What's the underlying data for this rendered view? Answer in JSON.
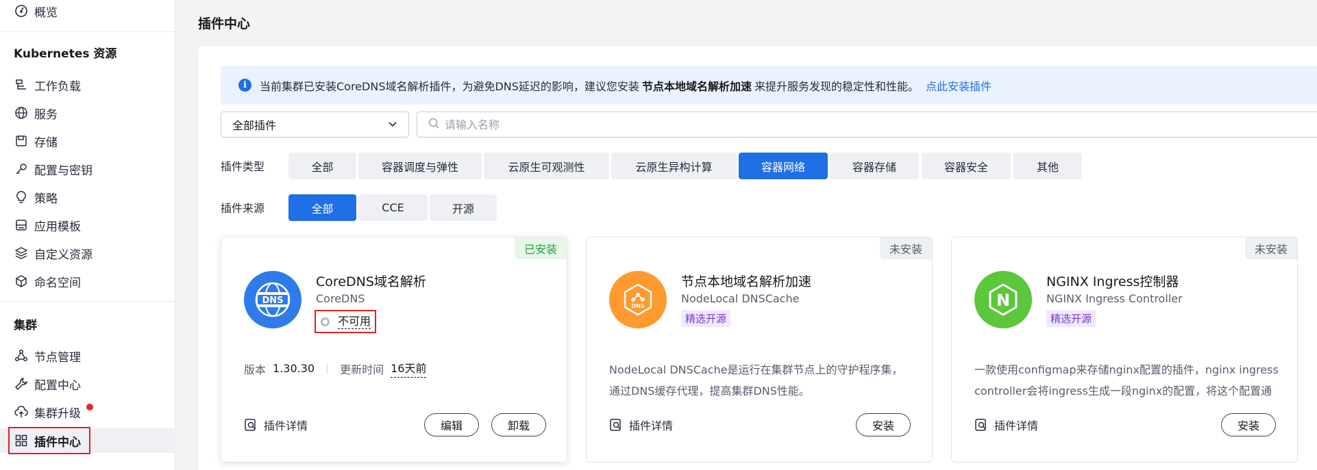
{
  "sidebar": {
    "overview": "概览",
    "k8s_section": "Kubernetes 资源",
    "items": [
      {
        "label": "工作负载",
        "icon": "workload-icon"
      },
      {
        "label": "服务",
        "icon": "globe-icon"
      },
      {
        "label": "存储",
        "icon": "storage-icon"
      },
      {
        "label": "配置与密钥",
        "icon": "key-icon"
      },
      {
        "label": "策略",
        "icon": "bulb-icon"
      },
      {
        "label": "应用模板",
        "icon": "template-icon"
      },
      {
        "label": "自定义资源",
        "icon": "layers-icon"
      },
      {
        "label": "命名空间",
        "icon": "cube-icon"
      }
    ],
    "cluster_section": "集群",
    "cluster_items": [
      {
        "label": "节点管理",
        "icon": "node-icon"
      },
      {
        "label": "配置中心",
        "icon": "wrench-icon"
      },
      {
        "label": "集群升级",
        "icon": "cloud-upload-icon"
      },
      {
        "label": "插件中心",
        "icon": "grid-icon"
      }
    ]
  },
  "header": {
    "title": "插件中心"
  },
  "notice": {
    "text_before": "当前集群已安装CoreDNS域名解析插件，为避免DNS延迟的影响，建议您安装",
    "bold": "节点本地域名解析加速",
    "text_after": "来提升服务发现的稳定性和性能。",
    "link": "点此安装插件"
  },
  "filters": {
    "select_value": "全部插件",
    "search_placeholder": "请输入名称",
    "type_label": "插件类型",
    "types": [
      "全部",
      "容器调度与弹性",
      "云原生可观测性",
      "云原生异构计算",
      "容器网络",
      "容器存储",
      "容器安全",
      "其他"
    ],
    "type_selected": "容器网络",
    "source_label": "插件来源",
    "sources": [
      "全部",
      "CCE",
      "开源"
    ],
    "source_selected": "全部"
  },
  "cards": [
    {
      "badge": "已安装",
      "title": "CoreDNS域名解析",
      "subtitle": "CoreDNS",
      "status": "不可用",
      "version_label": "版本",
      "version": "1.30.30",
      "updated_label": "更新时间",
      "updated": "16天前",
      "detail": "插件详情",
      "edit": "编辑",
      "uninstall": "卸载",
      "logo_text": "DNS"
    },
    {
      "badge": "未安装",
      "title": "节点本地域名解析加速",
      "subtitle": "NodeLocal DNSCache",
      "tag": "精选开源",
      "desc1": "NodeLocal DNSCache是运行在集群节点上的守护程序集，",
      "desc2": "通过DNS缓存代理，提高集群DNS性能。",
      "detail": "插件详情",
      "install": "安装",
      "logo_text": "DNS"
    },
    {
      "badge": "未安装",
      "title": "NGINX Ingress控制器",
      "subtitle": "NGINX Ingress Controller",
      "tag": "精选开源",
      "desc1": "一款使用configmap来存储nginx配置的插件，nginx ingress",
      "desc2": "controller会将ingress生成一段nginx的配置，将这个配置通",
      "detail": "插件详情",
      "install": "安装",
      "logo_text": "N"
    }
  ],
  "colors": {
    "primary": "#1f6fe5",
    "installed_badge": "#2d9f47",
    "tag_purple": "#7a37d1",
    "highlight_red": "#e02020"
  }
}
